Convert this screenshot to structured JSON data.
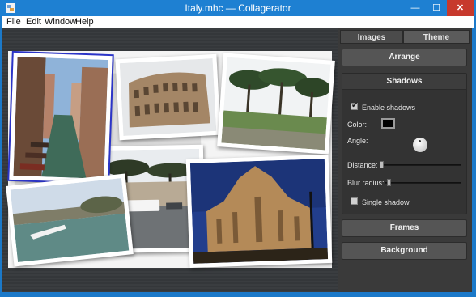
{
  "window": {
    "title": "Italy.mhc — Collagerator",
    "minimize": "—",
    "maximize": "☐",
    "close": "✕"
  },
  "menu": {
    "file": "File",
    "edit": "Edit",
    "window": "Window",
    "help": "Help"
  },
  "canvas": {
    "photos": [
      {
        "name": "venice-canal-photo",
        "selected": true
      },
      {
        "name": "colosseum-photo",
        "selected": false
      },
      {
        "name": "pine-park-photo",
        "selected": false
      },
      {
        "name": "street-pines-photo",
        "selected": false
      },
      {
        "name": "river-boat-photo",
        "selected": false
      },
      {
        "name": "milan-cathedral-photo",
        "selected": false
      }
    ]
  },
  "panel": {
    "tabs": {
      "images": "Images",
      "theme": "Theme"
    },
    "arrange_label": "Arrange",
    "shadows": {
      "title": "Shadows",
      "enable_label": "Enable shadows",
      "enable_checked": true,
      "color_label": "Color:",
      "color_value": "#000000",
      "angle_label": "Angle:",
      "distance_label": "Distance:",
      "distance_fraction": 0.0,
      "blur_label": "Blur radius:",
      "blur_fraction": 0.03,
      "single_label": "Single shadow",
      "single_checked": false
    },
    "frames_label": "Frames",
    "background_label": "Background"
  }
}
